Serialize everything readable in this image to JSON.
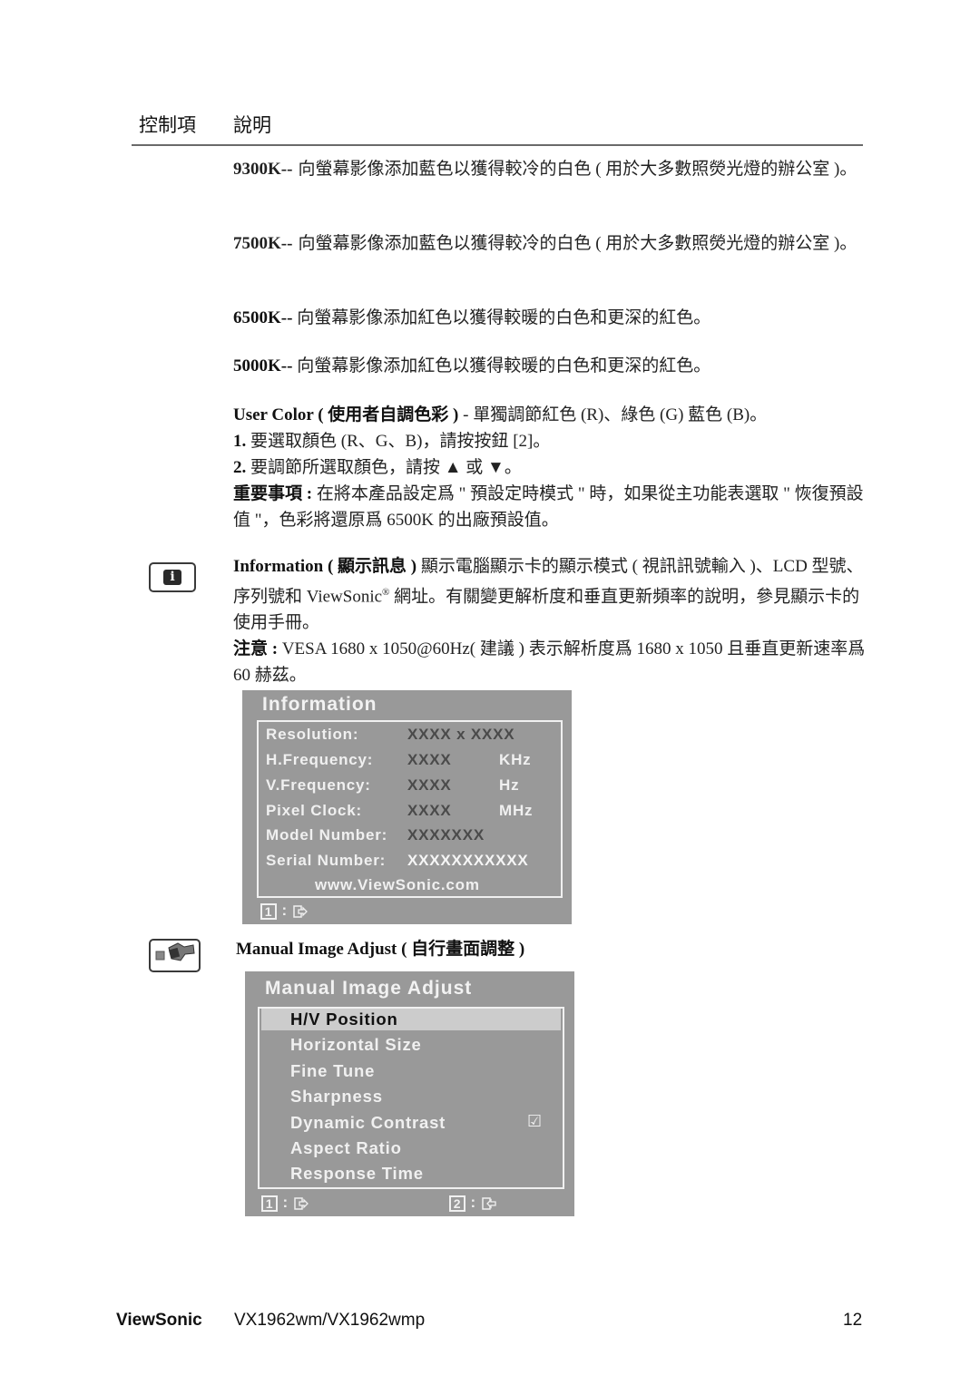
{
  "header": {
    "col_control": "控制項",
    "col_desc": "說明"
  },
  "presets": [
    {
      "key": "9300K--",
      "desc": "向螢幕影像添加藍色以獲得較冷的白色 ( 用於大多數照熒光燈的辦公室 )。"
    },
    {
      "key": "7500K--",
      "desc": "向螢幕影像添加藍色以獲得較冷的白色 ( 用於大多數照熒光燈的辦公室 )。"
    },
    {
      "key": "6500K--",
      "desc": "向螢幕影像添加紅色以獲得較暖的白色和更深的紅色。"
    },
    {
      "key": "5000K--",
      "desc": "向螢幕影像添加紅色以獲得較暖的白色和更深的紅色。"
    }
  ],
  "user_color": {
    "title": "User Color ( 使用者自調色彩 )",
    "desc": " - 單獨調節紅色 (R)、綠色 (G) 藍色 (B)。",
    "step1_num": "1.",
    "step1": " 要選取顏色 (R、G、B)，請按按鈕 [2]。",
    "step2_num": "2.",
    "step2": " 要調節所選取顏色，請按 ▲ 或 ▼。",
    "important_label": "重要事項 :",
    "important_text": " 在將本產品設定爲 \" 預設定時模式 \" 時，如果從主功能表選取 \" 恢復預設值 \"，色彩將還原爲 6500K 的出廠預設值。"
  },
  "information": {
    "icon": "info-icon",
    "title": "Information ( 顯示訊息 )",
    "desc_1": " 顯示電腦顯示卡的顯示模式 ( 視訊訊號輸入 )、LCD 型號、序列號和 ViewSonic",
    "reg_mark": "®",
    "desc_2": " 網址。有關變更解析度和垂直更新頻率的說明，參見顯示卡的使用手冊。",
    "note_label": "注意 :",
    "note_text": " VESA 1680 x 1050@60Hz( 建議 ) 表示解析度爲 1680 x 1050 且垂直更新速率爲 60 赫茲。"
  },
  "info_osd": {
    "title": "Information",
    "rows": [
      {
        "label": "Resolution:",
        "value": "XXXX x XXXX",
        "unit": ""
      },
      {
        "label": "H.Frequency:",
        "value": "XXXX",
        "unit": "KHz"
      },
      {
        "label": "V.Frequency:",
        "value": "XXXX",
        "unit": "Hz"
      },
      {
        "label": "Pixel Clock:",
        "value": "XXXX",
        "unit": "MHz"
      },
      {
        "label": "Model Number:",
        "value": "XXXXXXX",
        "unit": ""
      },
      {
        "label": "Serial Number:",
        "value": "XXXXXXXXXXX",
        "unit": ""
      }
    ],
    "url": "www.ViewSonic.com",
    "key1": "1",
    "colon": ":"
  },
  "manual_adjust": {
    "icon": "wrench-icon",
    "title": "Manual Image Adjust ( 自行畫面調整 )"
  },
  "manual_osd": {
    "title": "Manual Image Adjust",
    "items": [
      {
        "label": "H/V Position",
        "selected": true
      },
      {
        "label": "Horizontal Size"
      },
      {
        "label": "Fine Tune"
      },
      {
        "label": "Sharpness"
      },
      {
        "label": "Dynamic Contrast",
        "checkbox": "☑"
      },
      {
        "label": "Aspect Ratio"
      },
      {
        "label": "Response Time"
      }
    ],
    "key1": "1",
    "key2": "2",
    "colon": ":"
  },
  "footer": {
    "brand": "ViewSonic",
    "model": "VX1962wm/VX1962wmp",
    "page": "12"
  }
}
